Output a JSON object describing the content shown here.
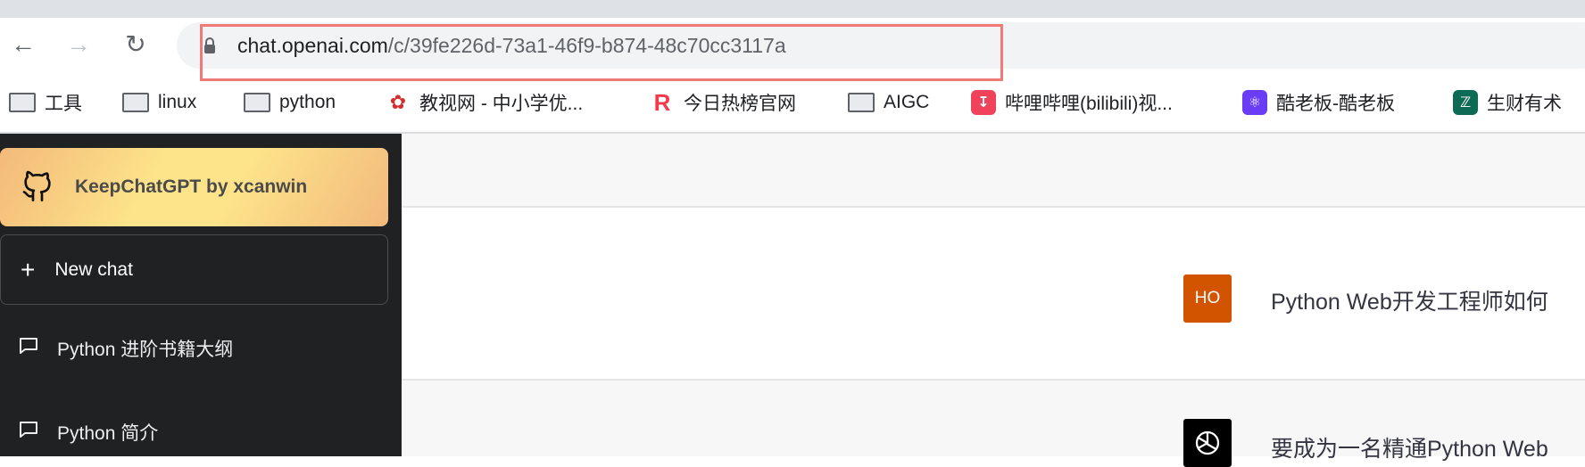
{
  "browser": {
    "url_host": "chat.openai.com",
    "url_path": "/c/39fe226d-73a1-46f9-b874-48c70cc3117a",
    "icons": {
      "back": "arrow-left-icon",
      "forward": "arrow-right-icon",
      "reload": "reload-icon",
      "lock": "lock-icon"
    },
    "highlight_color": "#f07a76",
    "bookmarks": [
      {
        "label": "工具",
        "icon": "folder"
      },
      {
        "label": "linux",
        "icon": "folder"
      },
      {
        "label": "python",
        "icon": "folder"
      },
      {
        "label": "教视网 - 中小学优...",
        "icon": "weibo"
      },
      {
        "label": "今日热榜官网",
        "icon": "R"
      },
      {
        "label": "AIGC",
        "icon": "folder"
      },
      {
        "label": "哔哩哔哩(bilibili)视...",
        "icon": "download"
      },
      {
        "label": "酷老板-酷老板",
        "icon": "atom"
      },
      {
        "label": "生财有术",
        "icon": "coin"
      }
    ]
  },
  "sidebar": {
    "keep_label": "KeepChatGPT by xcanwin",
    "new_chat_label": "New chat",
    "history": [
      {
        "label": "Python 进阶书籍大纲"
      },
      {
        "label": "Python 简介"
      }
    ]
  },
  "conversation": {
    "user_avatar": "HO",
    "user_avatar_color": "#d35400",
    "user_message": "Python Web开发工程师如何",
    "assistant_message": "要成为一名精通Python Web"
  }
}
